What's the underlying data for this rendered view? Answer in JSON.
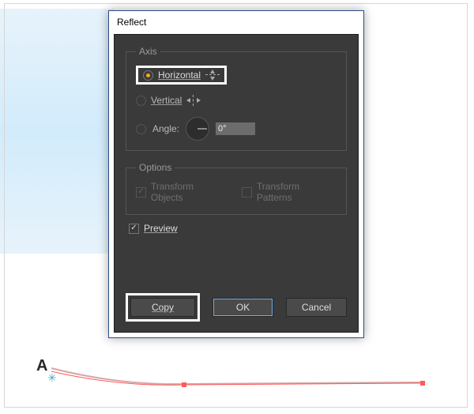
{
  "dialog": {
    "title": "Reflect",
    "axis": {
      "legend": "Axis",
      "horizontal_label": "Horizontal",
      "vertical_label": "Vertical",
      "angle_label": "Angle:",
      "angle_value": "0°"
    },
    "options": {
      "legend": "Options",
      "transform_objects_label": "Transform Objects",
      "transform_patterns_label": "Transform Patterns"
    },
    "preview_label": "Preview",
    "buttons": {
      "copy": "Copy",
      "ok": "OK",
      "cancel": "Cancel"
    }
  },
  "canvas": {
    "marker_label": "A"
  }
}
